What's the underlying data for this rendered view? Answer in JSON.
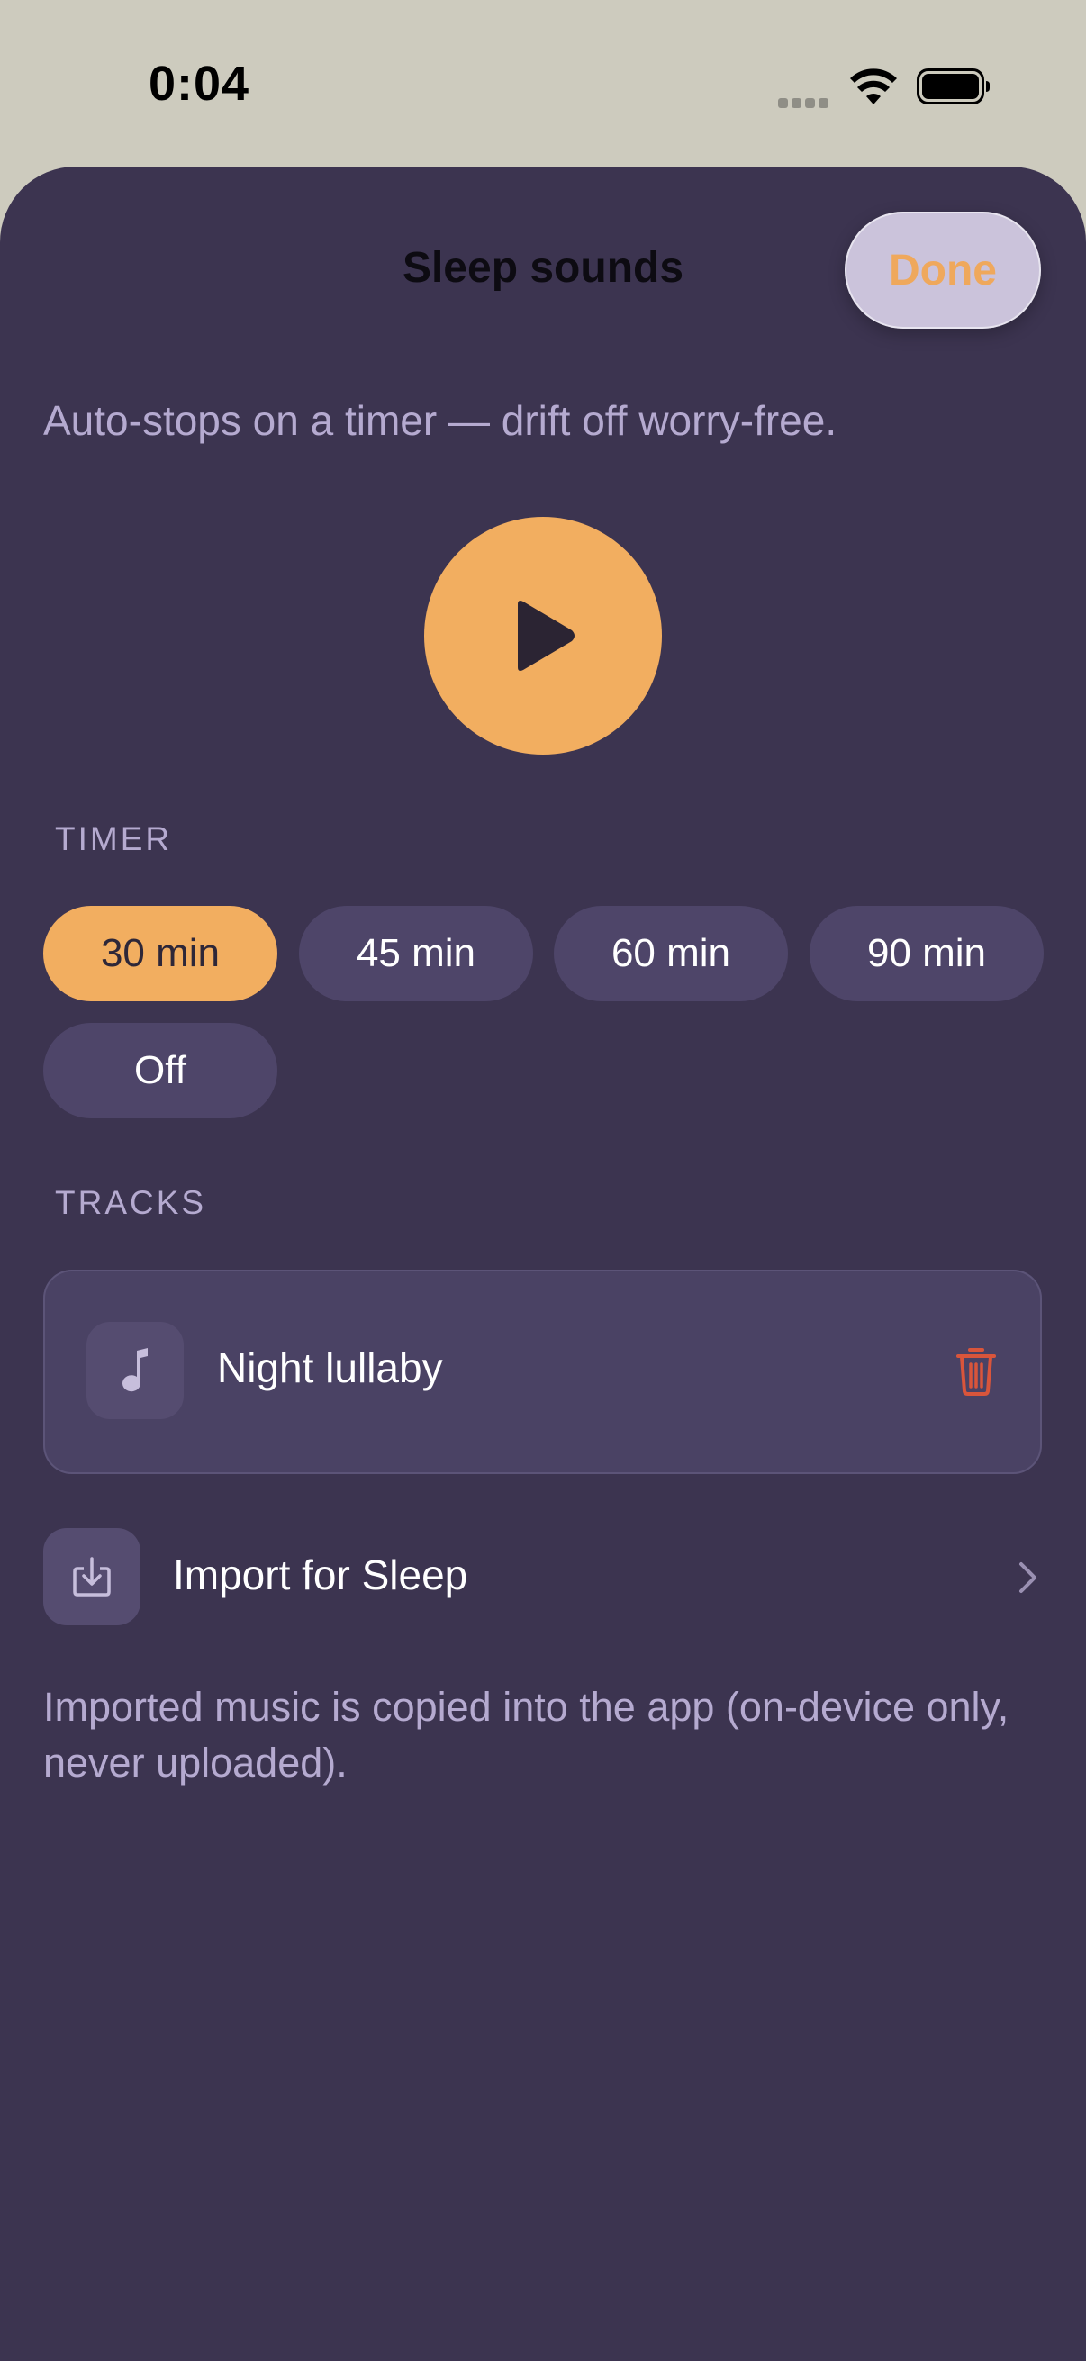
{
  "status_bar": {
    "time": "0:04"
  },
  "nav": {
    "title": "Sleep sounds",
    "done_label": "Done"
  },
  "subtitle": "Auto-stops on a timer — drift off worry-free.",
  "player": {
    "state": "paused",
    "play_icon": "play-icon"
  },
  "timer": {
    "section_label": "TIMER",
    "options": [
      "30 min",
      "45 min",
      "60 min",
      "90 min",
      "Off"
    ],
    "selected": "30 min"
  },
  "tracks": {
    "section_label": "TRACKS",
    "items": [
      {
        "name": "Night lullaby",
        "icon": "music-note-icon",
        "action_icon": "trash-icon"
      }
    ]
  },
  "import": {
    "label": "Import for Sleep",
    "icon": "import-icon"
  },
  "footnote": "Imported music is copied into the app (on-device only, never uploaded).",
  "colors": {
    "accent": "#F2AE60",
    "sheet_background": "#3C3450",
    "chip_background": "#4E4569",
    "secondary_text": "#B5AAD0",
    "destructive": "#D9553B"
  }
}
